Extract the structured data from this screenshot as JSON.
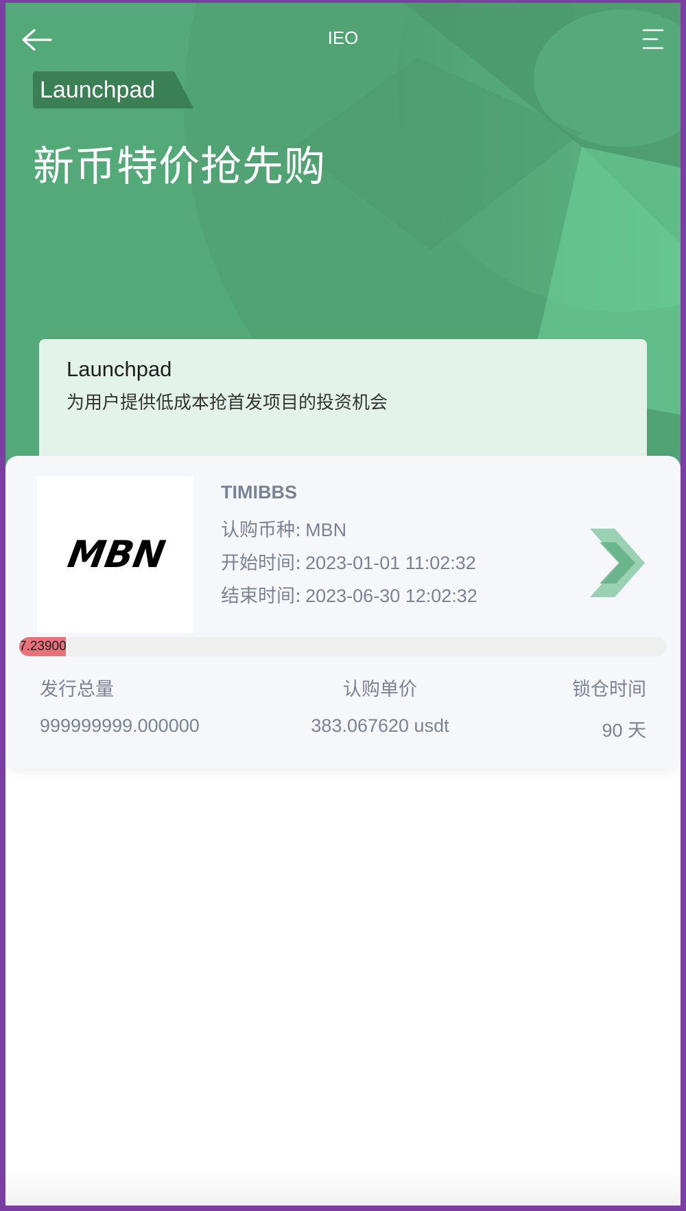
{
  "header": {
    "title": "IEO",
    "back_icon": "arrow-left-icon",
    "menu_icon": "menu-icon"
  },
  "hero": {
    "tag": "Launchpad",
    "title": "新币特价抢先购",
    "background_color": "#54a978"
  },
  "intro": {
    "title": "Launchpad",
    "subtitle": "为用户提供低成本抢首发项目的投资机会"
  },
  "project": {
    "name": "TIMIBBS",
    "logo_text": "MBN",
    "rows": [
      {
        "label": "认购币种:",
        "value": "MBN"
      },
      {
        "label": "开始时间:",
        "value": "2023-01-01 11:02:32"
      },
      {
        "label": "结束时间:",
        "value": "2023-06-30 12:02:32"
      }
    ],
    "progress": {
      "text": "7.2390000",
      "percent": 7.239,
      "color": "#e7727a"
    },
    "stats": {
      "headers": [
        "发行总量",
        "认购单价",
        "锁仓时间"
      ],
      "values": [
        "999999999.000000",
        "383.067620 usdt",
        "90 天"
      ]
    },
    "chevron_icon": "double-chevron-right-icon"
  }
}
